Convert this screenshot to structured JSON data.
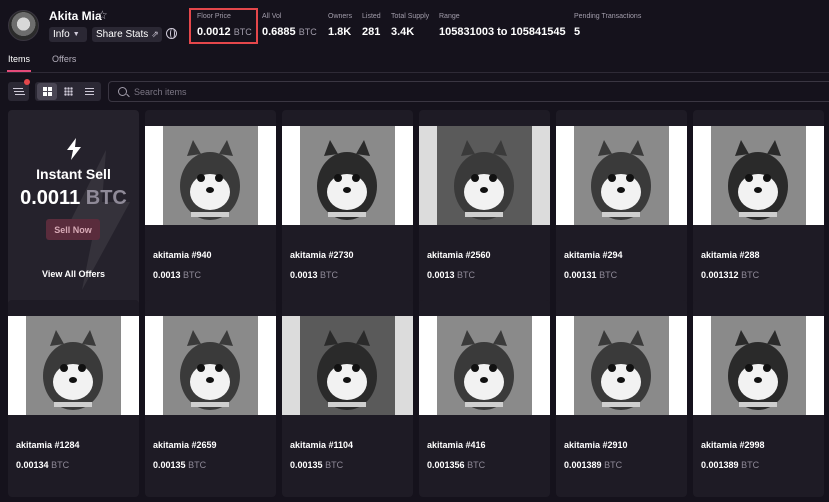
{
  "collection": {
    "name": "Akita Mia",
    "info_label": "Info",
    "share_label": "Share Stats"
  },
  "stats": [
    {
      "label": "Floor Price",
      "value": "0.0012",
      "unit": "BTC"
    },
    {
      "label": "All Vol",
      "value": "0.6885",
      "unit": "BTC"
    },
    {
      "label": "Owners",
      "value": "1.8K",
      "unit": ""
    },
    {
      "label": "Listed",
      "value": "281",
      "unit": ""
    },
    {
      "label": "Total Supply",
      "value": "3.4K",
      "unit": ""
    },
    {
      "label": "Range",
      "value": "105831003 to 105841545",
      "unit": ""
    },
    {
      "label": "Pending Transactions",
      "value": "5",
      "unit": ""
    }
  ],
  "tabs": [
    {
      "label": "Items"
    },
    {
      "label": "Offers"
    }
  ],
  "search": {
    "placeholder": "Search items"
  },
  "instant_sell": {
    "title": "Instant Sell",
    "price": "0.0011",
    "unit": "BTC",
    "button": "Sell Now",
    "view_offers": "View All Offers"
  },
  "items": [
    {
      "name": "akitamia #940",
      "price": "0.0013",
      "unit": "BTC"
    },
    {
      "name": "akitamia #2730",
      "price": "0.0013",
      "unit": "BTC"
    },
    {
      "name": "akitamia #2560",
      "price": "0.0013",
      "unit": "BTC"
    },
    {
      "name": "akitamia #294",
      "price": "0.00131",
      "unit": "BTC"
    },
    {
      "name": "akitamia #288",
      "price": "0.001312",
      "unit": "BTC"
    },
    {
      "name": "akitamia #1284",
      "price": "0.00134",
      "unit": "BTC"
    },
    {
      "name": "akitamia #2659",
      "price": "0.00135",
      "unit": "BTC"
    },
    {
      "name": "akitamia #1104",
      "price": "0.00135",
      "unit": "BTC"
    },
    {
      "name": "akitamia #416",
      "price": "0.001356",
      "unit": "BTC"
    },
    {
      "name": "akitamia #2910",
      "price": "0.001389",
      "unit": "BTC"
    },
    {
      "name": "akitamia #2998",
      "price": "0.001389",
      "unit": "BTC"
    }
  ],
  "colors": {
    "background": "#15121c",
    "card": "#1e1b25",
    "accent": "#e54b7a",
    "highlight_box": "#e5474b"
  },
  "icons": [
    "star-icon",
    "chevron-down-icon",
    "share-icon",
    "globe-icon",
    "filter-icon",
    "grid-large-icon",
    "grid-small-icon",
    "list-icon",
    "search-icon",
    "bolt-icon"
  ]
}
